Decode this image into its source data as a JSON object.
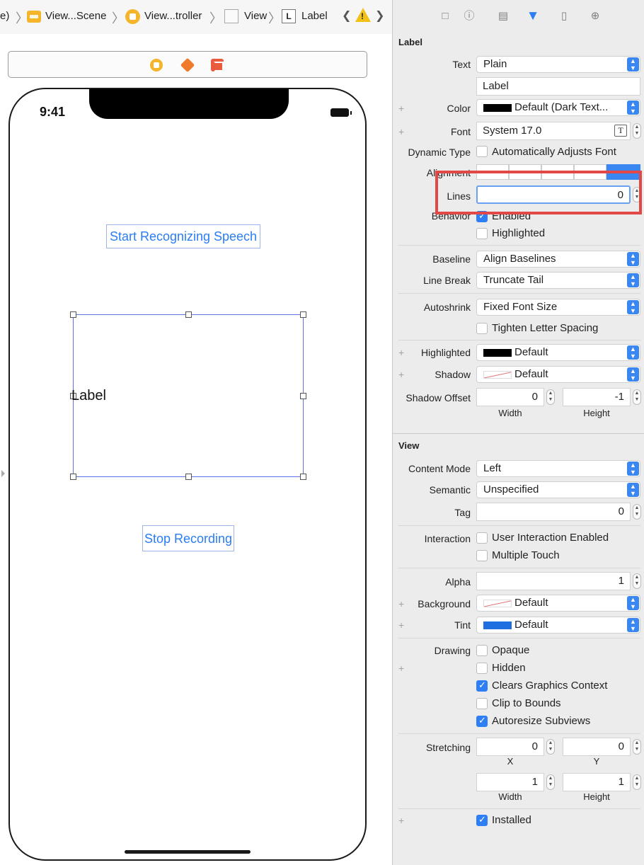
{
  "breadcrumb": {
    "partial_prefix": "e)",
    "items": [
      "View...Scene",
      "View...troller",
      "View",
      "Label"
    ],
    "label_icon_letter": "L",
    "nav_prev": "❮",
    "nav_next": "❯",
    "warning": "!"
  },
  "canvas": {
    "status_time": "9:41",
    "start_button": "Start Recognizing Speech",
    "label_text": "Label",
    "stop_button": "Stop Recording"
  },
  "inspector": {
    "label_section": {
      "title": "Label",
      "text_label": "Text",
      "text_type": "Plain",
      "text_value": "Label",
      "color_label": "Color",
      "color_value": "Default (Dark Text...",
      "font_label": "Font",
      "font_value": "System 17.0",
      "dynamic_type_label": "Dynamic Type",
      "dynamic_type_option": "Automatically Adjusts Font",
      "alignment_label": "Alignment",
      "lines_label": "Lines",
      "lines_value": "0",
      "behavior_label": "Behavior",
      "behavior_enabled": "Enabled",
      "behavior_highlighted": "Highlighted",
      "baseline_label": "Baseline",
      "baseline_value": "Align Baselines",
      "line_break_label": "Line Break",
      "line_break_value": "Truncate Tail",
      "autoshrink_label": "Autoshrink",
      "autoshrink_value": "Fixed Font Size",
      "tighten_label": "Tighten Letter Spacing",
      "highlighted_label": "Highlighted",
      "highlighted_value": "Default",
      "shadow_label": "Shadow",
      "shadow_value": "Default",
      "shadow_offset_label": "Shadow Offset",
      "shadow_offset_width": "0",
      "shadow_offset_height": "-1",
      "width_label": "Width",
      "height_label": "Height"
    },
    "view_section": {
      "title": "View",
      "content_mode_label": "Content Mode",
      "content_mode_value": "Left",
      "semantic_label": "Semantic",
      "semantic_value": "Unspecified",
      "tag_label": "Tag",
      "tag_value": "0",
      "interaction_label": "Interaction",
      "user_interaction": "User Interaction Enabled",
      "multiple_touch": "Multiple Touch",
      "alpha_label": "Alpha",
      "alpha_value": "1",
      "background_label": "Background",
      "background_value": "Default",
      "tint_label": "Tint",
      "tint_value": "Default",
      "drawing_label": "Drawing",
      "opaque": "Opaque",
      "hidden": "Hidden",
      "clears_graphics": "Clears Graphics Context",
      "clip_to_bounds": "Clip to Bounds",
      "autoresize": "Autoresize Subviews",
      "stretching_label": "Stretching",
      "stretch_x": "0",
      "stretch_y": "0",
      "x_label": "X",
      "y_label": "Y",
      "stretch_width": "1",
      "stretch_height": "1",
      "width_label": "Width",
      "height_label": "Height",
      "installed": "Installed"
    }
  },
  "colors": {
    "accent": "#2e7ef5",
    "highlight_frame": "#e24848",
    "canvas_button_text": "#2a7df4",
    "scene_icon": "#f4b52b"
  }
}
